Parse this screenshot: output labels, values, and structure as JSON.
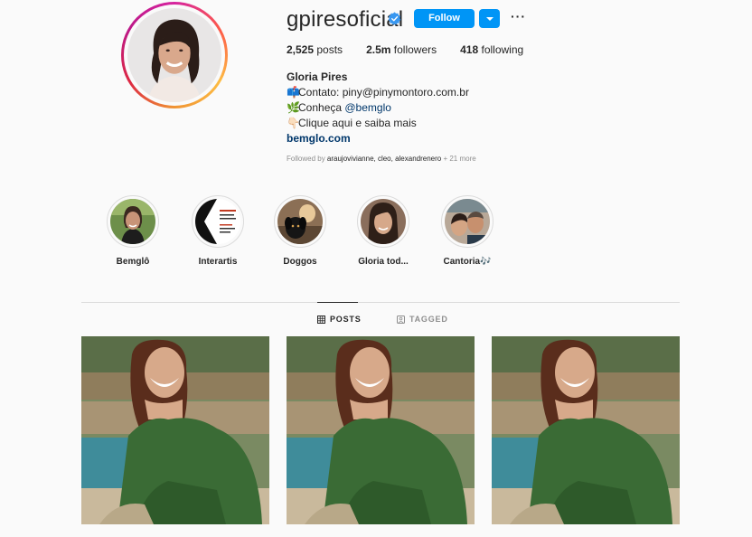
{
  "profile": {
    "username": "gpiresoficial",
    "verified": true,
    "follow_label": "Follow",
    "accent_color": "#0095f6",
    "stats": {
      "posts_count": "2,525",
      "posts_label": "posts",
      "followers_count": "2.5m",
      "followers_label": "followers",
      "following_count": "418",
      "following_label": "following"
    },
    "full_name": "Gloria Pires",
    "bio": {
      "line1_emoji": "📫",
      "line1_text": "Contato: piny@pinymontoro.com.br",
      "line2_emoji": "🌿",
      "line2_text": "Conheça ",
      "line2_mention": "@bemglo",
      "line3_emoji": "👇🏻",
      "line3_text": "Clique aqui e saiba mais",
      "website": "bemglo.com"
    },
    "followed_by": {
      "prefix": "Followed by ",
      "names": "araujovivianne, cleo, alexandrenero",
      "suffix": " + 21 more"
    }
  },
  "highlights": [
    {
      "label": "Bemglô"
    },
    {
      "label": "Interartis"
    },
    {
      "label": "Doggos"
    },
    {
      "label": "Gloria tod..."
    },
    {
      "label": "Cantoria🎶"
    }
  ],
  "tabs": {
    "posts": "POSTS",
    "tagged": "TAGGED"
  },
  "icons": {
    "verified": "verified-badge-icon",
    "more": "more-options-icon",
    "posts_tab": "grid-icon",
    "tagged_tab": "tag-user-icon"
  }
}
